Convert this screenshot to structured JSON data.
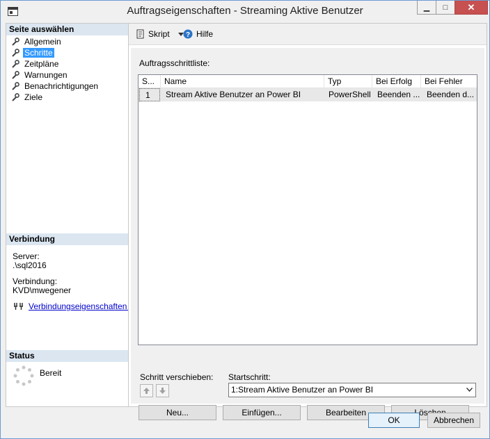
{
  "window": {
    "title": "Auftragseigenschaften - Streaming Aktive Benutzer",
    "minimize": "▁",
    "maximize": "□",
    "close": "✕"
  },
  "sidebar": {
    "heading": "Seite auswählen",
    "items": [
      {
        "label": "Allgemein"
      },
      {
        "label": "Schritte",
        "selected": true
      },
      {
        "label": "Zeitpläne"
      },
      {
        "label": "Warnungen"
      },
      {
        "label": "Benachrichtigungen"
      },
      {
        "label": "Ziele"
      }
    ]
  },
  "connection": {
    "heading": "Verbindung",
    "server_label": "Server:",
    "server_value": ".\\sql2016",
    "connection_label": "Verbindung:",
    "connection_value": "KVD\\mwegener",
    "properties_link": "Verbindungseigenschaften anzeigen"
  },
  "status": {
    "heading": "Status",
    "text": "Bereit"
  },
  "toolbar": {
    "script_label": "Skript",
    "help_label": "Hilfe"
  },
  "steps": {
    "list_label": "Auftragsschrittliste:",
    "columns": [
      "S...",
      "Name",
      "Typ",
      "Bei Erfolg",
      "Bei Fehler"
    ],
    "rows": [
      {
        "step": "1",
        "name": "Stream Aktive Benutzer an Power BI",
        "type": "PowerShell",
        "on_success": "Beenden ...",
        "on_failure": "Beenden d..."
      }
    ],
    "move_label": "Schritt verschieben:",
    "start_label": "Startschritt:",
    "start_value": "1:Stream Aktive Benutzer an Power BI"
  },
  "buttons": {
    "new": "Neu...",
    "insert": "Einfügen...",
    "edit": "Bearbeiten",
    "delete": "Löschen",
    "ok": "OK",
    "cancel": "Abbrechen"
  },
  "colors": {
    "selection": "#3399ff",
    "section_header": "#dbe6f1",
    "close_button": "#c75050",
    "link": "#0000cc"
  }
}
